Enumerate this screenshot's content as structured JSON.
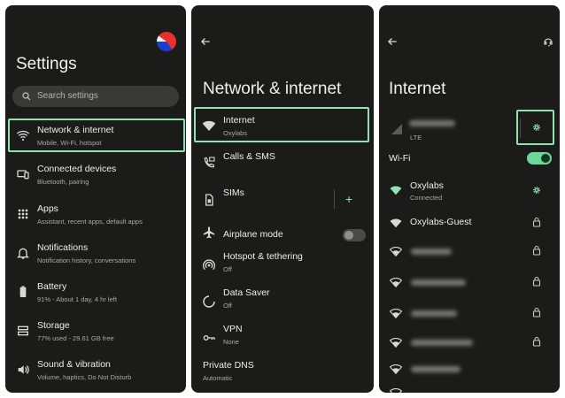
{
  "colors": {
    "panel_bg": "#1b1c1a",
    "accent": "#8fe3b0",
    "highlight_border": "#8fe3b0",
    "text": "#eeeeea",
    "subtext": "#a9aaa5"
  },
  "settings": {
    "title": "Settings",
    "search_placeholder": "Search settings",
    "items": [
      {
        "icon": "wifi-icon",
        "title": "Network & internet",
        "subtitle": "Mobile, Wi-Fi, hotspot",
        "highlighted": true
      },
      {
        "icon": "devices-icon",
        "title": "Connected devices",
        "subtitle": "Bluetooth, pairing"
      },
      {
        "icon": "apps-grid-icon",
        "title": "Apps",
        "subtitle": "Assistant, recent apps, default apps"
      },
      {
        "icon": "bell-icon",
        "title": "Notifications",
        "subtitle": "Notification history, conversations"
      },
      {
        "icon": "battery-icon",
        "title": "Battery",
        "subtitle": "91% - About 1 day, 4 hr left"
      },
      {
        "icon": "storage-icon",
        "title": "Storage",
        "subtitle": "77% used - 29.61 GB free"
      },
      {
        "icon": "volume-icon",
        "title": "Sound & vibration",
        "subtitle": "Volume, haptics, Do Not Disturb"
      }
    ]
  },
  "network": {
    "title": "Network & internet",
    "items": [
      {
        "icon": "wifi-icon",
        "title": "Internet",
        "subtitle": "Oxylabs",
        "highlighted": true
      },
      {
        "icon": "calls-sms-icon",
        "title": "Calls & SMS",
        "subtitle": ""
      },
      {
        "icon": "sim-icon",
        "title": "SIMs",
        "subtitle": "",
        "action": "+"
      },
      {
        "icon": "airplane-icon",
        "title": "Airplane mode",
        "subtitle": "",
        "toggle": false
      },
      {
        "icon": "hotspot-icon",
        "title": "Hotspot & tethering",
        "subtitle": "Off"
      },
      {
        "icon": "data-saver-icon",
        "title": "Data Saver",
        "subtitle": "Off"
      },
      {
        "icon": "vpn-icon",
        "title": "VPN",
        "subtitle": "None"
      },
      {
        "icon": "",
        "title": "Private DNS",
        "subtitle": "Automatic"
      }
    ]
  },
  "internet": {
    "title": "Internet",
    "mobile_sub": "LTE",
    "wifi_label": "Wi-Fi",
    "wifi_on": true,
    "networks": [
      {
        "name": "Oxylabs",
        "status": "Connected",
        "action": "gear-icon"
      },
      {
        "name": "Oxylabs-Guest",
        "status": "",
        "action": "lock-icon"
      }
    ]
  }
}
